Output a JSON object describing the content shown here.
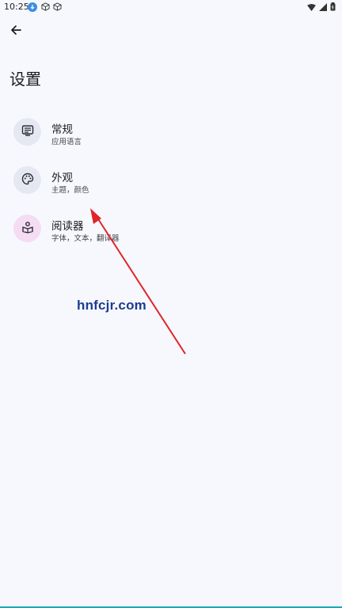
{
  "status_bar": {
    "time": "10:25"
  },
  "header": {
    "title": "设置"
  },
  "settings": [
    {
      "title": "常规",
      "subtitle": "应用语言",
      "icon": "app-settings-icon",
      "icon_bg": "#e5e8f2"
    },
    {
      "title": "外观",
      "subtitle": "主题，颜色",
      "icon": "palette-icon",
      "icon_bg": "#e5e8f2"
    },
    {
      "title": "阅读器",
      "subtitle": "字体，文本，翻译器",
      "icon": "book-reader-icon",
      "icon_bg": "#f5dcf5"
    }
  ],
  "watermark": {
    "text": "hnfcjr.com"
  },
  "colors": {
    "background": "#f7f8fd",
    "annotation_arrow": "#e0242a",
    "watermark": "#1c3d8f"
  }
}
